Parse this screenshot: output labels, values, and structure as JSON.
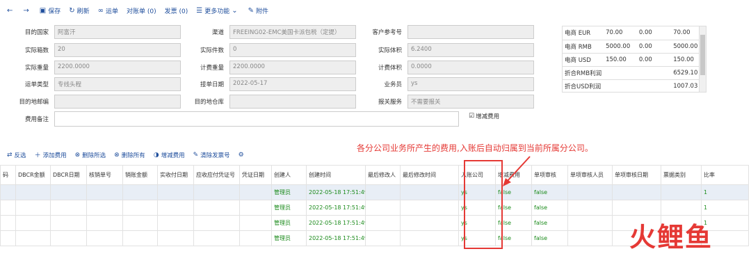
{
  "toolbar": [
    "保存",
    "刷新",
    "运单",
    "对账单 (0)",
    "发票 (0)",
    "更多功能",
    "附件"
  ],
  "form": {
    "dest_country": {
      "label": "目的国家",
      "value": "阿富汗"
    },
    "channel": {
      "label": "渠道",
      "value": "FREEING02-EMC美国卡派包税（定提）"
    },
    "cust_ref": {
      "label": "客户参考号",
      "value": ""
    },
    "boxes": {
      "label": "实际箱数",
      "value": "20"
    },
    "pieces": {
      "label": "实际件数",
      "value": "0"
    },
    "volume": {
      "label": "实际体积",
      "value": "6.2400"
    },
    "weight": {
      "label": "实际重量",
      "value": "2200.0000"
    },
    "chg_weight": {
      "label": "计费重量",
      "value": "2200.0000"
    },
    "chg_volume": {
      "label": "计费体积",
      "value": "0.0000"
    },
    "ship_type": {
      "label": "运单类型",
      "value": "专线头程"
    },
    "recv_date": {
      "label": "接单日期",
      "value": "2022-05-17"
    },
    "salesman": {
      "label": "业务员",
      "value": "ys"
    },
    "dest_zip": {
      "label": "目的地邮编",
      "value": ""
    },
    "dest_wh": {
      "label": "目的地仓库",
      "value": ""
    },
    "customs": {
      "label": "报关服务",
      "value": "不需要报关"
    },
    "fee_note": {
      "label": "费用备注",
      "value": ""
    },
    "adj_fee": "增减费用"
  },
  "currency": [
    [
      "电商 EUR",
      "70.00",
      "0.00",
      "70.00"
    ],
    [
      "电商 RMB",
      "5000.00",
      "0.00",
      "5000.00"
    ],
    [
      "电商 USD",
      "150.00",
      "0.00",
      "150.00"
    ],
    [
      "折合RMB利润",
      "",
      "",
      "6529.10"
    ],
    [
      "折合USD利润",
      "",
      "",
      "1007.03"
    ]
  ],
  "toolbar2": [
    "反选",
    "添加费用",
    "删除所选",
    "删除所有",
    "增减费用",
    "清除发票号"
  ],
  "annotation": "各分公司业务所产生的费用,入账后自动归属到当前所属分公司。",
  "grid": {
    "headers": [
      "码",
      "DBCR金额",
      "DBCR日期",
      "核销单号",
      "销账金额",
      "实收付日期",
      "应收应付凭证号",
      "凭证日期",
      "创建人",
      "创建时间",
      "最后修改人",
      "最后修改时间",
      "入账公司",
      "增减费用",
      "单项审核",
      "单项审核人员",
      "单项审核日期",
      "票据类别",
      "比率"
    ],
    "rows": [
      [
        "",
        "",
        "",
        "",
        "",
        "",
        "",
        "",
        "管理员",
        "2022-05-18 17:51:49",
        "",
        "",
        "ys",
        "false",
        "false",
        "",
        "",
        "",
        "1"
      ],
      [
        "",
        "",
        "",
        "",
        "",
        "",
        "",
        "",
        "管理员",
        "2022-05-18 17:51:49",
        "",
        "",
        "ys",
        "false",
        "false",
        "",
        "",
        "",
        "1"
      ],
      [
        "",
        "",
        "",
        "",
        "",
        "",
        "",
        "",
        "管理员",
        "2022-05-18 17:51:49",
        "",
        "",
        "ys",
        "false",
        "false",
        "",
        "",
        "",
        "1"
      ],
      [
        "",
        "",
        "",
        "",
        "",
        "",
        "",
        "",
        "管理员",
        "2022-05-18 17:51:49",
        "",
        "",
        "ys",
        "false",
        "false",
        "",
        "",
        "",
        "1"
      ]
    ]
  },
  "logo": "火鲤鱼"
}
